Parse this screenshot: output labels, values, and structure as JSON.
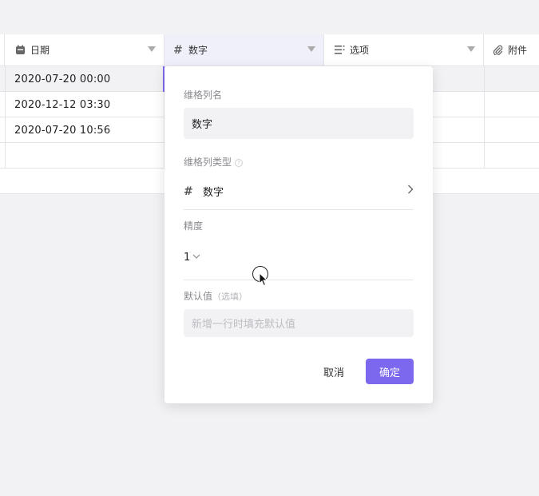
{
  "columns": [
    {
      "label": "日期",
      "icon": "calendar-icon"
    },
    {
      "label": "数字",
      "icon": "hash-icon"
    },
    {
      "label": "选项",
      "icon": "list-icon"
    },
    {
      "label": "附件",
      "icon": "paperclip-icon"
    }
  ],
  "rows": [
    {
      "date": "2020-07-20  00:00"
    },
    {
      "date": "2020-12-12  03:30"
    },
    {
      "date": "2020-07-20  10:56"
    },
    {
      "date": ""
    }
  ],
  "popup": {
    "name_label": "维格列名",
    "name_value": "数字",
    "type_label": "维格列类型",
    "type_help": "?",
    "type_value": "数字",
    "precision_label": "精度",
    "precision_value": "1",
    "default_label": "默认值",
    "default_hint": "（选填）",
    "default_placeholder": "新增一行时填充默认值",
    "cancel": "取消",
    "confirm": "确定"
  },
  "colors": {
    "accent": "#7b68ee"
  }
}
